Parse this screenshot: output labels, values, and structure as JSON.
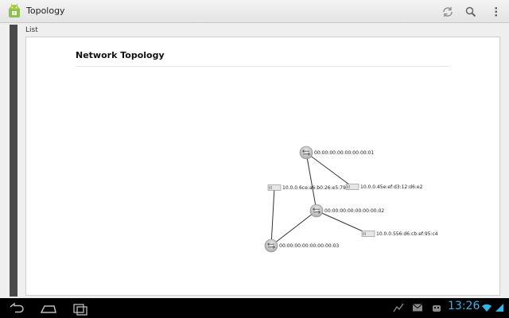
{
  "app": {
    "title": "Topology"
  },
  "toolbar": {
    "refresh": "refresh-icon",
    "search": "search-icon",
    "overflow": "overflow-icon"
  },
  "tab": {
    "label": "List"
  },
  "card": {
    "title": "Network Topology"
  },
  "topology": {
    "switches": [
      {
        "id": "00:00:00:00:00:00:00:01"
      },
      {
        "id": "00:00:00:00:00:00:00:02"
      },
      {
        "id": "00:00:00:00:00:00:00:03"
      }
    ],
    "hosts": [
      {
        "id": "10.0.0.6ce:a6:b0:26:e5:79"
      },
      {
        "id": "10.0.0.45e:ef:d3:12:d6:e2"
      },
      {
        "id": "10.0.0.556:d6:cb:ef:95:c4"
      }
    ]
  },
  "statusbar": {
    "time": "13:26"
  },
  "colors": {
    "clock": "#33b5e5",
    "strip": "#4a4a4a"
  }
}
